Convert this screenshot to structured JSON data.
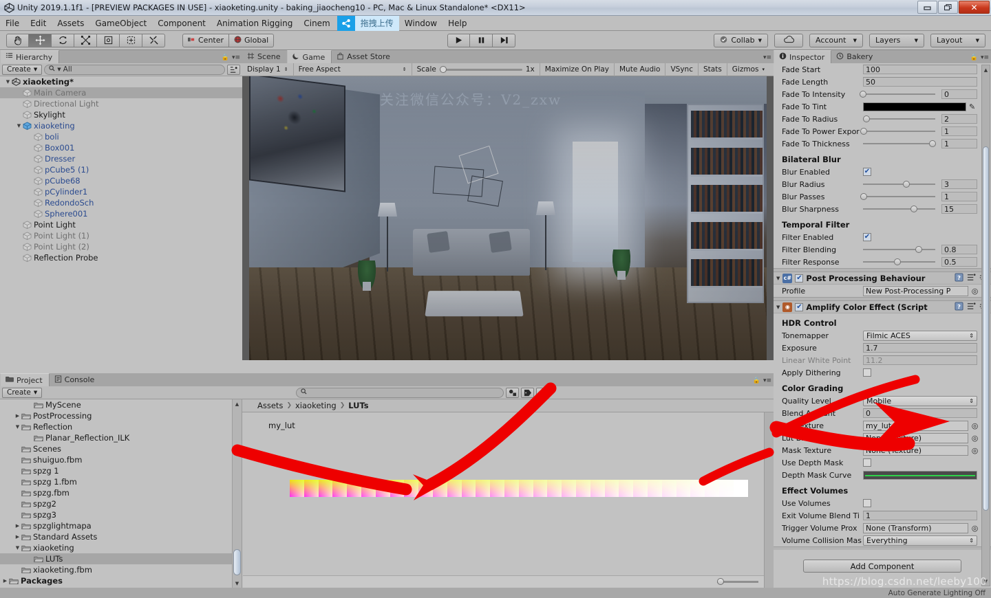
{
  "window": {
    "title": "Unity 2019.1.1f1 - [PREVIEW PACKAGES IN USE] - xiaoketing.unity - baking_jiaocheng10 - PC, Mac & Linux Standalone* <DX11>",
    "buttons": {
      "minimize": "—",
      "maximize": "❐",
      "close": "✕"
    }
  },
  "menubar": {
    "items": [
      "File",
      "Edit",
      "Assets",
      "GameObject",
      "Component",
      "Animation Rigging",
      "Cinem",
      "Window",
      "Help"
    ],
    "plugin": {
      "icon": "wechat-share-icon",
      "label": "拖拽上传"
    }
  },
  "toolbar": {
    "tools": [
      {
        "name": "hand-tool",
        "glyph": "✋",
        "active": false
      },
      {
        "name": "move-tool",
        "glyph": "✥",
        "active": true
      },
      {
        "name": "rotate-tool",
        "glyph": "↻",
        "active": false
      },
      {
        "name": "scale-tool",
        "glyph": "⤢",
        "active": false
      },
      {
        "name": "rect-tool",
        "glyph": "▣",
        "active": false
      },
      {
        "name": "transform-tool",
        "glyph": "◈",
        "active": false
      },
      {
        "name": "custom-tool",
        "glyph": "⚒",
        "active": false
      }
    ],
    "pivot": "Center",
    "handle": "Global",
    "play": "▶",
    "pause": "❙❙",
    "step": "▶❙",
    "collab": "Collab",
    "cloud": "☁",
    "account": "Account",
    "layers": "Layers",
    "layout": "Layout"
  },
  "hierarchy": {
    "tab": "Hierarchy",
    "create": "Create",
    "search_placeholder": "All",
    "items": [
      {
        "label": "xiaoketing*",
        "depth": 0,
        "style": "root",
        "expanded": true,
        "icon": "unity-scene-icon"
      },
      {
        "label": "Main Camera",
        "depth": 1,
        "style": "dim",
        "selected": true,
        "icon": "gameobject-icon"
      },
      {
        "label": "Directional Light",
        "depth": 1,
        "style": "dim",
        "icon": "gameobject-icon"
      },
      {
        "label": "Skylight",
        "depth": 1,
        "style": "norm",
        "icon": "gameobject-icon"
      },
      {
        "label": "xiaoketing",
        "depth": 1,
        "style": "prefab",
        "expanded": true,
        "icon": "prefab-icon"
      },
      {
        "label": "boli",
        "depth": 2,
        "style": "prefab",
        "icon": "gameobject-icon"
      },
      {
        "label": "Box001",
        "depth": 2,
        "style": "prefab",
        "icon": "gameobject-icon"
      },
      {
        "label": "Dresser",
        "depth": 2,
        "style": "prefab",
        "icon": "gameobject-icon"
      },
      {
        "label": "pCube5 (1)",
        "depth": 2,
        "style": "prefab",
        "icon": "gameobject-icon"
      },
      {
        "label": "pCube68",
        "depth": 2,
        "style": "prefab",
        "icon": "gameobject-icon"
      },
      {
        "label": "pCylinder1",
        "depth": 2,
        "style": "prefab",
        "icon": "gameobject-icon"
      },
      {
        "label": "RedondoSch",
        "depth": 2,
        "style": "prefab",
        "icon": "gameobject-icon"
      },
      {
        "label": "Sphere001",
        "depth": 2,
        "style": "prefab",
        "icon": "gameobject-icon"
      },
      {
        "label": "Point Light",
        "depth": 1,
        "style": "norm",
        "icon": "gameobject-icon"
      },
      {
        "label": "Point Light (1)",
        "depth": 1,
        "style": "dim",
        "icon": "gameobject-icon"
      },
      {
        "label": "Point Light (2)",
        "depth": 1,
        "style": "dim",
        "icon": "gameobject-icon"
      },
      {
        "label": "Reflection Probe",
        "depth": 1,
        "style": "norm",
        "icon": "gameobject-icon"
      }
    ]
  },
  "gameview": {
    "tabs": [
      {
        "label": "Scene",
        "icon": "scene-grid-icon",
        "active": false
      },
      {
        "label": "Game",
        "icon": "game-icon",
        "active": true
      },
      {
        "label": "Asset Store",
        "icon": "store-icon",
        "active": false
      }
    ],
    "display": "Display 1",
    "aspect": "Free Aspect",
    "scale_label": "Scale",
    "scale_value": "1x",
    "maximize": "Maximize On Play",
    "mute": "Mute Audio",
    "vsync": "VSync",
    "stats": "Stats",
    "gizmos": "Gizmos",
    "watermark": "关注微信公众号：V2_zxw"
  },
  "inspector": {
    "tabs": [
      {
        "label": "Inspector",
        "icon": "info-icon",
        "active": true
      },
      {
        "label": "Bakery",
        "icon": "bakery-icon",
        "active": false
      }
    ],
    "rows": [
      {
        "type": "field",
        "label": "Fade Start",
        "value": "100",
        "clipped": true
      },
      {
        "type": "field",
        "label": "Fade Length",
        "value": "50"
      },
      {
        "type": "slider",
        "label": "Fade To Intensity",
        "value": "0",
        "pos": 0
      },
      {
        "type": "color",
        "label": "Fade To Tint",
        "value": "#000000"
      },
      {
        "type": "slider",
        "label": "Fade To Radius",
        "value": "2",
        "pos": 5
      },
      {
        "type": "slider",
        "label": "Fade To Power Expor",
        "value": "1",
        "pos": 1
      },
      {
        "type": "slider",
        "label": "Fade To Thickness",
        "value": "1",
        "pos": 96
      },
      {
        "type": "section",
        "label": "Bilateral Blur"
      },
      {
        "type": "checkbox",
        "label": "Blur Enabled",
        "checked": true
      },
      {
        "type": "slider",
        "label": "Blur Radius",
        "value": "3",
        "pos": 60
      },
      {
        "type": "slider",
        "label": "Blur Passes",
        "value": "1",
        "pos": 1
      },
      {
        "type": "slider",
        "label": "Blur Sharpness",
        "value": "15",
        "pos": 70
      },
      {
        "type": "section",
        "label": "Temporal Filter"
      },
      {
        "type": "checkbox",
        "label": "Filter Enabled",
        "checked": true
      },
      {
        "type": "slider",
        "label": "Filter Blending",
        "value": "0.8",
        "pos": 77
      },
      {
        "type": "slider",
        "label": "Filter Response",
        "value": "0.5",
        "pos": 48
      }
    ],
    "components": [
      {
        "name": "Post Processing Behaviour",
        "enabled": true,
        "icon": "csharp-script-icon",
        "icon_color": "#4a6fa5",
        "rows": [
          {
            "type": "object",
            "label": "Profile",
            "value": "New Post-Processing P",
            "icon": "asset-icon"
          }
        ]
      },
      {
        "name": "Amplify Color Effect (Script",
        "enabled": true,
        "icon": "amplify-icon",
        "icon_color": "#b05a2a",
        "rows": [
          {
            "type": "section",
            "label": "HDR Control"
          },
          {
            "type": "dropdown",
            "label": "Tonemapper",
            "value": "Filmic ACES"
          },
          {
            "type": "field",
            "label": "Exposure",
            "value": "1.7"
          },
          {
            "type": "field",
            "label": "Linear White Point",
            "value": "11.2",
            "dim": true
          },
          {
            "type": "checkbox",
            "label": "Apply Dithering",
            "checked": false
          },
          {
            "type": "section",
            "label": "Color Grading"
          },
          {
            "type": "dropdown",
            "label": "Quality Level",
            "value": "Mobile"
          },
          {
            "type": "field",
            "label": "Blend Amount",
            "value": "0"
          },
          {
            "type": "object",
            "label": "Lut Texture",
            "value": "my_lut",
            "highlight": true
          },
          {
            "type": "object",
            "label": "Lut Blend Texture",
            "value": "None (Texture)"
          },
          {
            "type": "object",
            "label": "Mask Texture",
            "value": "None (Texture)"
          },
          {
            "type": "checkbox",
            "label": "Use Depth Mask",
            "checked": false
          },
          {
            "type": "curve",
            "label": "Depth Mask Curve",
            "color": "#2fd44a"
          },
          {
            "type": "section",
            "label": "Effect Volumes"
          },
          {
            "type": "checkbox",
            "label": "Use Volumes",
            "checked": false
          },
          {
            "type": "field",
            "label": "Exit Volume Blend Ti",
            "value": "1"
          },
          {
            "type": "object",
            "label": "Trigger Volume Prox",
            "value": "None (Transform)"
          },
          {
            "type": "dropdown",
            "label": "Volume Collision Mas",
            "value": "Everything"
          }
        ]
      }
    ],
    "add_component": "Add Component"
  },
  "project": {
    "tabs": [
      {
        "label": "Project",
        "icon": "folder-icon",
        "active": true
      },
      {
        "label": "Console",
        "icon": "console-icon",
        "active": false
      }
    ],
    "create": "Create",
    "search_placeholder": "",
    "tree": [
      {
        "label": "MyScene",
        "depth": 2,
        "arrow": ""
      },
      {
        "label": "PostProcessing",
        "depth": 1,
        "arrow": "▶"
      },
      {
        "label": "Reflection",
        "depth": 1,
        "arrow": "▼"
      },
      {
        "label": "Planar_Reflection_ILK",
        "depth": 2,
        "arrow": ""
      },
      {
        "label": "Scenes",
        "depth": 1,
        "arrow": ""
      },
      {
        "label": "shuiguo.fbm",
        "depth": 1,
        "arrow": ""
      },
      {
        "label": "spzg 1",
        "depth": 1,
        "arrow": ""
      },
      {
        "label": "spzg 1.fbm",
        "depth": 1,
        "arrow": ""
      },
      {
        "label": "spzg.fbm",
        "depth": 1,
        "arrow": ""
      },
      {
        "label": "spzg2",
        "depth": 1,
        "arrow": ""
      },
      {
        "label": "spzg3",
        "depth": 1,
        "arrow": ""
      },
      {
        "label": "spzglightmapa",
        "depth": 1,
        "arrow": "▶"
      },
      {
        "label": "Standard Assets",
        "depth": 1,
        "arrow": "▶"
      },
      {
        "label": "xiaoketing",
        "depth": 1,
        "arrow": "▼"
      },
      {
        "label": "LUTs",
        "depth": 2,
        "arrow": "",
        "selected": true
      },
      {
        "label": "xiaoketing.fbm",
        "depth": 1,
        "arrow": ""
      },
      {
        "label": "Packages",
        "depth": 0,
        "arrow": "▶",
        "bold": true
      }
    ],
    "breadcrumb": [
      "Assets",
      "xiaoketing",
      "LUTs"
    ],
    "asset": {
      "name": "my_lut",
      "type": "lut-texture-strip",
      "cells": 32
    },
    "toolbar_icons": [
      "object-filter-icon",
      "label-filter-icon",
      "favorite-icon"
    ]
  },
  "statusbar": {
    "text": "Auto Generate Lighting Off",
    "watermark": "https://blog.csdn.net/leeby100"
  },
  "colors": {
    "accent_blue": "#1aa0e8",
    "panel_bg": "#c2c2c2",
    "tab_bg": "#a5a5a5",
    "arrow_red": "#ee0000",
    "prefab_text": "#2a4a8f"
  }
}
